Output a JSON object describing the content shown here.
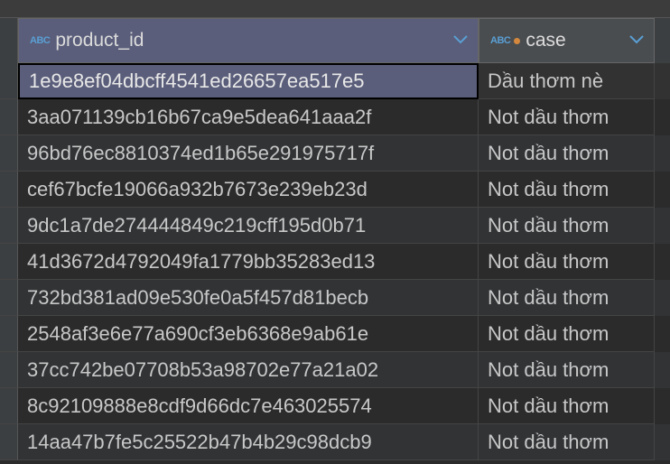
{
  "columns": [
    {
      "type_badge": "ABC",
      "label": "product_id",
      "has_dot": false
    },
    {
      "type_badge": "ABC",
      "label": "case",
      "has_dot": true
    }
  ],
  "rows": [
    {
      "product_id": "1e9e8ef04dbcff4541ed26657ea517e5",
      "case": "Dầu thơm nè"
    },
    {
      "product_id": "3aa071139cb16b67ca9e5dea641aaa2f",
      "case": "Not dầu thơm"
    },
    {
      "product_id": "96bd76ec8810374ed1b65e291975717f",
      "case": "Not dầu thơm"
    },
    {
      "product_id": "cef67bcfe19066a932b7673e239eb23d",
      "case": "Not dầu thơm"
    },
    {
      "product_id": "9dc1a7de274444849c219cff195d0b71",
      "case": "Not dầu thơm"
    },
    {
      "product_id": "41d3672d4792049fa1779bb35283ed13",
      "case": "Not dầu thơm"
    },
    {
      "product_id": "732bd381ad09e530fe0a5f457d81becb",
      "case": "Not dầu thơm"
    },
    {
      "product_id": "2548af3e6e77a690cf3eb6368e9ab61e",
      "case": "Not dầu thơm"
    },
    {
      "product_id": "37cc742be07708b53a98702e77a21a02",
      "case": "Not dầu thơm"
    },
    {
      "product_id": "8c92109888e8cdf9d66dc7e463025574",
      "case": "Not dầu thơm"
    },
    {
      "product_id": "14aa47b7fe5c25522b47b4b29c98dcb9",
      "case": "Not dầu thơm"
    }
  ],
  "selected_row": 0,
  "selected_col": 0
}
